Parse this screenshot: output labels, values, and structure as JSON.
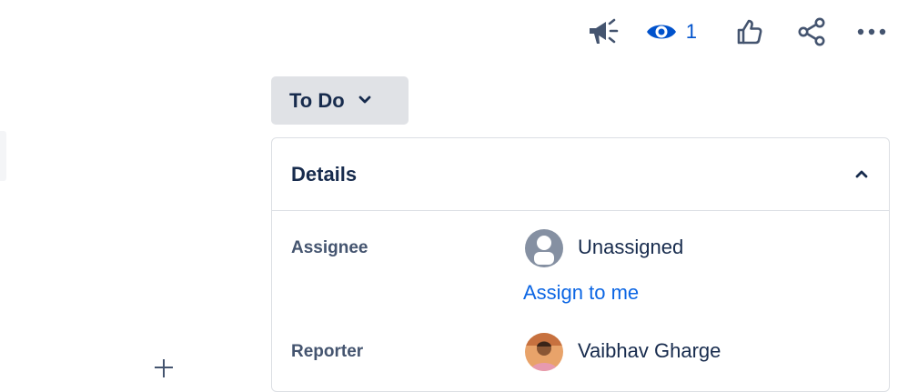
{
  "toolbar": {
    "icons": [
      "megaphone-icon",
      "eye-icon",
      "thumbs-up-icon",
      "share-icon",
      "more-icon"
    ],
    "watch_count": "1",
    "watch_color": "#0052cc"
  },
  "status": {
    "label": "To Do",
    "icon": "chevron-down-icon"
  },
  "details": {
    "title": "Details",
    "collapse_icon": "chevron-up-icon",
    "fields": {
      "assignee": {
        "label": "Assignee",
        "value": "Unassigned",
        "action": "Assign to me",
        "avatar": "default-user-avatar"
      },
      "reporter": {
        "label": "Reporter",
        "value": "Vaibhav Gharge",
        "avatar": "user-photo-avatar"
      }
    }
  },
  "colors": {
    "text": "#172b4d",
    "link": "#0c66e4",
    "status_bg": "#e0e2e6",
    "border": "#dcdfe4",
    "label": "#44546f"
  }
}
